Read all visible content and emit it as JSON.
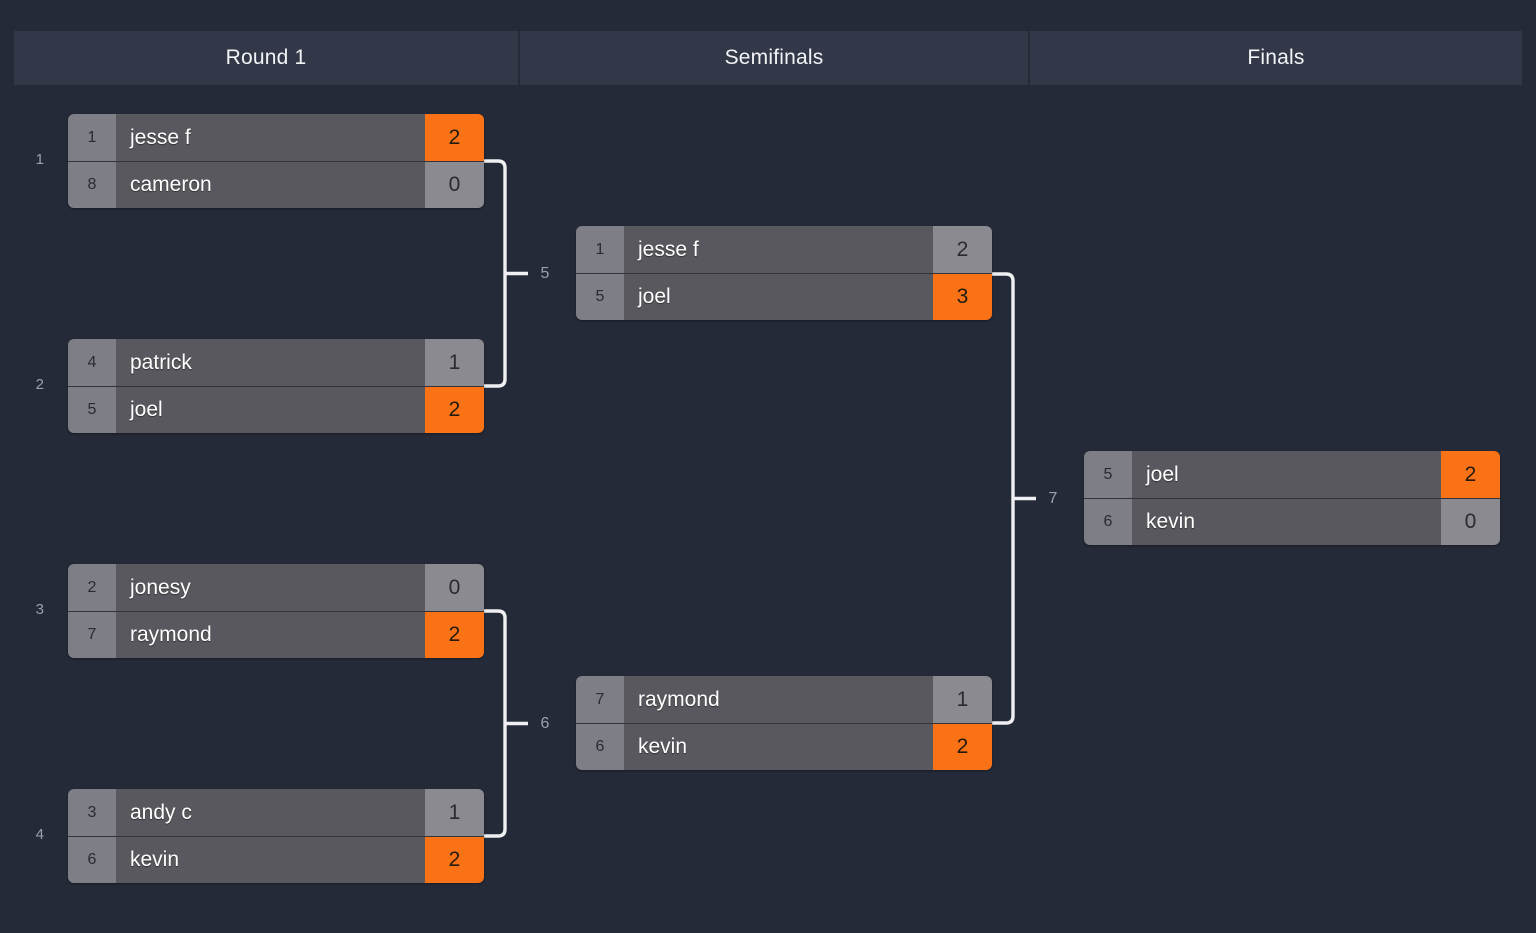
{
  "rounds": [
    {
      "label": "Round 1"
    },
    {
      "label": "Semifinals"
    },
    {
      "label": "Finals"
    }
  ],
  "matches": [
    {
      "number": "1",
      "round": "Round 1",
      "slots": [
        {
          "seed": "1",
          "name": "jesse f",
          "score": "2",
          "winner": true
        },
        {
          "seed": "8",
          "name": "cameron",
          "score": "0",
          "winner": false
        }
      ]
    },
    {
      "number": "2",
      "round": "Round 1",
      "slots": [
        {
          "seed": "4",
          "name": "patrick",
          "score": "1",
          "winner": false
        },
        {
          "seed": "5",
          "name": "joel",
          "score": "2",
          "winner": true
        }
      ]
    },
    {
      "number": "3",
      "round": "Round 1",
      "slots": [
        {
          "seed": "2",
          "name": "jonesy",
          "score": "0",
          "winner": false
        },
        {
          "seed": "7",
          "name": "raymond",
          "score": "2",
          "winner": true
        }
      ]
    },
    {
      "number": "4",
      "round": "Round 1",
      "slots": [
        {
          "seed": "3",
          "name": "andy c",
          "score": "1",
          "winner": false
        },
        {
          "seed": "6",
          "name": "kevin",
          "score": "2",
          "winner": true
        }
      ]
    },
    {
      "number": "5",
      "round": "Semifinals",
      "slots": [
        {
          "seed": "1",
          "name": "jesse f",
          "score": "2",
          "winner": false
        },
        {
          "seed": "5",
          "name": "joel",
          "score": "3",
          "winner": true
        }
      ]
    },
    {
      "number": "6",
      "round": "Semifinals",
      "slots": [
        {
          "seed": "7",
          "name": "raymond",
          "score": "1",
          "winner": false
        },
        {
          "seed": "6",
          "name": "kevin",
          "score": "2",
          "winner": true
        }
      ]
    },
    {
      "number": "7",
      "round": "Finals",
      "slots": [
        {
          "seed": "5",
          "name": "joel",
          "score": "2",
          "winner": true
        },
        {
          "seed": "6",
          "name": "kevin",
          "score": "0",
          "winner": false
        }
      ]
    }
  ],
  "connector_labels": [
    {
      "match_number": "5"
    },
    {
      "match_number": "6"
    },
    {
      "match_number": "7"
    }
  ],
  "colors": {
    "background": "#252a38",
    "header_bar": "#333848",
    "winner_score": "#f97316",
    "loser_score": "#8a8a90",
    "seed_cell": "#7e7e86",
    "name_cell": "#58585e",
    "connector": "#f0f0f2",
    "label_text": "#9aa0ae"
  }
}
